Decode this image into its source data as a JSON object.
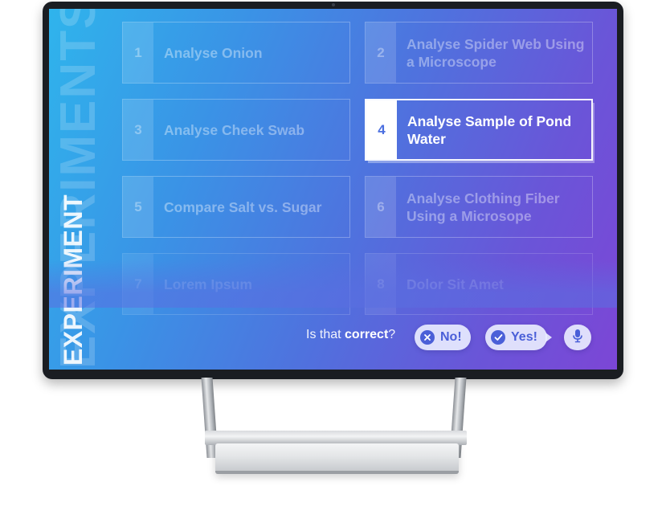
{
  "sidebar": {
    "title": "EXPERIMENT",
    "ghost_title": "EXPERIMENTS"
  },
  "experiments": [
    {
      "number": "1",
      "label": "Analyse Onion"
    },
    {
      "number": "2",
      "label": "Analyse  Spider Web Using a Microscope"
    },
    {
      "number": "3",
      "label": "Analyse Cheek Swab"
    },
    {
      "number": "4",
      "label": "Analyse Sample of Pond Water"
    },
    {
      "number": "5",
      "label": "Compare Salt vs. Sugar"
    },
    {
      "number": "6",
      "label": "Analyse Clothing Fiber Using a Microsope"
    },
    {
      "number": "7",
      "label": "Lorem Ipsum"
    },
    {
      "number": "8",
      "label": "Dolor Sit Amet"
    }
  ],
  "selected_number": "4",
  "confirm": {
    "question_prefix": "Is that ",
    "question_bold": "correct",
    "question_suffix": "?",
    "no_label": "No!",
    "yes_label": "Yes!"
  },
  "icons": {
    "no": "close-circle-icon",
    "yes": "check-circle-icon",
    "mic": "microphone-icon"
  },
  "colors": {
    "gradient_start": "#2fb4ec",
    "gradient_end": "#7c46d6",
    "accent": "#4a5fd8"
  }
}
